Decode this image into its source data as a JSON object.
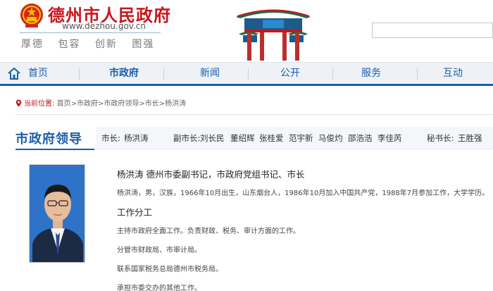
{
  "header": {
    "site_title": "德州市人民政府",
    "site_url": "www.dezhou.gov.cn",
    "slogans": [
      "厚德",
      "包容",
      "创新",
      "图强"
    ],
    "search_placeholder": ""
  },
  "nav": {
    "items": [
      {
        "label": "首页",
        "active": false
      },
      {
        "label": "市政府",
        "active": true
      },
      {
        "label": "新闻",
        "active": false
      },
      {
        "label": "公开",
        "active": false
      },
      {
        "label": "服务",
        "active": false
      },
      {
        "label": "互动",
        "active": false
      }
    ]
  },
  "breadcrumb": {
    "label": "当前位置:",
    "items": [
      "首页",
      ">市政府",
      ">市政府领导",
      ">市长",
      ">杨洪涛"
    ]
  },
  "leaders": {
    "section_title": "市政府领导",
    "mayor_label": "市长:",
    "mayor": "杨洪涛",
    "vice_label": "副市长:",
    "vice_mayors": [
      "刘长民",
      "董绍辉",
      "张桂爱",
      "范宇新",
      "马俊灼",
      "邵浩浩",
      "李佳芮"
    ],
    "secretary_label": "秘书长:",
    "secretary": "王胜强"
  },
  "profile": {
    "title": "杨洪涛 德州市委副书记，市政府党组书记、市长",
    "bio": "杨洪涛，男，汉族，1966年10月出生，山东烟台人，1986年10月加入中国共产党，1988年7月参加工作，大学学历。",
    "duty_heading": "工作分工",
    "duties": [
      "主持市政府全面工作。负责财政、税务、审计方面的工作。",
      "分管市财政局、市审计局。",
      "联系国家税务总局德州市税务局。",
      "承担市委交办的其他工作。"
    ]
  },
  "colors": {
    "brand_red": "#c8161d",
    "nav_blue": "#1a5ea8",
    "nav_bg": "#eef2f7"
  }
}
